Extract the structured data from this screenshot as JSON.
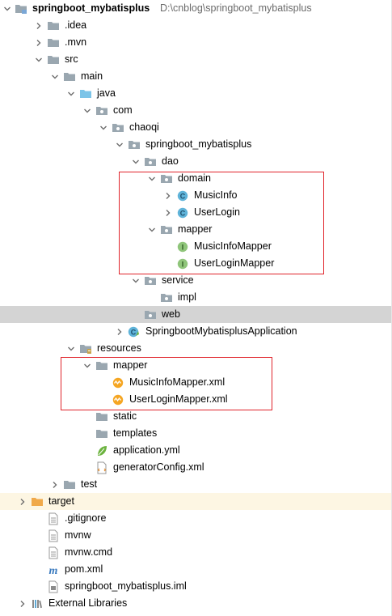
{
  "project": {
    "name": "springboot_mybatisplus",
    "path": "D:\\cnblog\\springboot_mybatisplus"
  },
  "nodes": [
    {
      "label": "springboot_mybatisplus",
      "icon": "project-folder-icon",
      "expand": "open",
      "bold": true,
      "name": "tree-node-project-root"
    },
    {
      "label": ".idea",
      "icon": "folder-icon",
      "expand": "closed",
      "name": "tree-node-idea"
    },
    {
      "label": ".mvn",
      "icon": "folder-icon",
      "expand": "closed",
      "name": "tree-node-mvn"
    },
    {
      "label": "src",
      "icon": "folder-icon",
      "expand": "open",
      "name": "tree-node-src"
    },
    {
      "label": "main",
      "icon": "folder-icon",
      "expand": "open",
      "name": "tree-node-main"
    },
    {
      "label": "java",
      "icon": "source-folder-icon",
      "expand": "open",
      "name": "tree-node-java"
    },
    {
      "label": "com",
      "icon": "package-icon",
      "expand": "open",
      "name": "tree-node-com"
    },
    {
      "label": "chaoqi",
      "icon": "package-icon",
      "expand": "open",
      "name": "tree-node-chaoqi"
    },
    {
      "label": "springboot_mybatisplus",
      "icon": "package-icon",
      "expand": "open",
      "name": "tree-node-springboot-package"
    },
    {
      "label": "dao",
      "icon": "package-icon",
      "expand": "open",
      "name": "tree-node-dao"
    },
    {
      "label": "domain",
      "icon": "package-icon",
      "expand": "open",
      "name": "tree-node-domain"
    },
    {
      "label": "MusicInfo",
      "icon": "class-icon",
      "expand": "closed",
      "name": "tree-node-musicinfo-class"
    },
    {
      "label": "UserLogin",
      "icon": "class-icon",
      "expand": "closed",
      "name": "tree-node-userlogin-class"
    },
    {
      "label": "mapper",
      "icon": "package-icon",
      "expand": "open",
      "name": "tree-node-dao-mapper"
    },
    {
      "label": "MusicInfoMapper",
      "icon": "interface-icon",
      "expand": "none",
      "name": "tree-node-musicinfomapper-interface"
    },
    {
      "label": "UserLoginMapper",
      "icon": "interface-icon",
      "expand": "none",
      "name": "tree-node-userloginmapper-interface"
    },
    {
      "label": "service",
      "icon": "package-icon",
      "expand": "open",
      "name": "tree-node-service"
    },
    {
      "label": "impl",
      "icon": "package-icon",
      "expand": "none",
      "name": "tree-node-impl"
    },
    {
      "label": "web",
      "icon": "package-icon",
      "expand": "none",
      "name": "tree-node-web",
      "state": "selected"
    },
    {
      "label": "SpringbootMybatisplusApplication",
      "icon": "spring-boot-class-icon",
      "expand": "closed",
      "name": "tree-node-application-class"
    },
    {
      "label": "resources",
      "icon": "resources-folder-icon",
      "expand": "open",
      "name": "tree-node-resources"
    },
    {
      "label": "mapper",
      "icon": "folder-icon",
      "expand": "open",
      "name": "tree-node-resources-mapper"
    },
    {
      "label": "MusicInfoMapper.xml",
      "icon": "xml-file-icon",
      "expand": "none",
      "name": "tree-node-musicinfomapper-xml"
    },
    {
      "label": "UserLoginMapper.xml",
      "icon": "xml-file-icon",
      "expand": "none",
      "name": "tree-node-userloginmapper-xml"
    },
    {
      "label": "static",
      "icon": "folder-icon",
      "expand": "none",
      "name": "tree-node-static"
    },
    {
      "label": "templates",
      "icon": "folder-icon",
      "expand": "none",
      "name": "tree-node-templates"
    },
    {
      "label": "application.yml",
      "icon": "spring-config-icon",
      "expand": "none",
      "name": "tree-node-application-yml"
    },
    {
      "label": "generatorConfig.xml",
      "icon": "xml-config-file-icon",
      "expand": "none",
      "name": "tree-node-generatorconfig-xml"
    },
    {
      "label": "test",
      "icon": "folder-icon",
      "expand": "closed",
      "name": "tree-node-test"
    },
    {
      "label": "target",
      "icon": "excluded-folder-icon",
      "expand": "closed",
      "name": "tree-node-target",
      "state": "highlighted"
    },
    {
      "label": ".gitignore",
      "icon": "text-file-icon",
      "expand": "none",
      "name": "tree-node-gitignore"
    },
    {
      "label": "mvnw",
      "icon": "text-file-icon",
      "expand": "none",
      "name": "tree-node-mvnw"
    },
    {
      "label": "mvnw.cmd",
      "icon": "text-file-icon",
      "expand": "none",
      "name": "tree-node-mvnw-cmd"
    },
    {
      "label": "pom.xml",
      "icon": "maven-icon",
      "expand": "none",
      "name": "tree-node-pom-xml"
    },
    {
      "label": "springboot_mybatisplus.iml",
      "icon": "iml-file-icon",
      "expand": "none",
      "name": "tree-node-iml"
    },
    {
      "label": "External Libraries",
      "icon": "libraries-icon",
      "expand": "closed",
      "name": "tree-node-external-libraries"
    }
  ],
  "colors": {
    "highlight_border": "#e0242b",
    "selected_row": "#d4d4d4",
    "target_row": "#fdf6e3",
    "folder": "#9aa7b0",
    "source_folder": "#7cc4e8",
    "class_badge": "#5fb3d9",
    "interface_badge": "#8fc57a",
    "excluded_folder": "#f0a94a"
  }
}
